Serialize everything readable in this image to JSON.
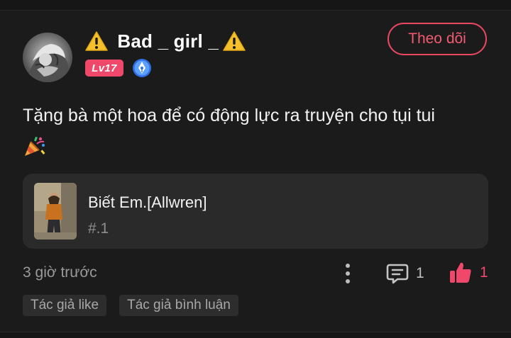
{
  "post": {
    "author": {
      "name": " Bad _ girl _",
      "level_badge": "Lv17",
      "avatar_icon": "avatar-icon",
      "name_icon": "warning-icon",
      "badge_icon": "pen-badge-icon"
    },
    "follow_label": "Theo dõi",
    "text": "Tặng bà một hoa để có động lực ra truyện cho tụi tui",
    "text_emoji_icon": "party-popper-icon",
    "story": {
      "title": "Biết Em.[Allwren]",
      "chapter": "#.1",
      "cover_icon": "story-cover-image"
    },
    "time_ago": "3 giờ trước",
    "comment_count": "1",
    "like_count": "1",
    "tags": [
      "Tác giả like",
      "Tác giả bình luận"
    ]
  },
  "colors": {
    "background": "#1b1b1b",
    "accent": "#f0486a",
    "card": "#2a2a2a",
    "muted_text": "#9a9a9a",
    "badge_blue": "#3b82f6"
  }
}
